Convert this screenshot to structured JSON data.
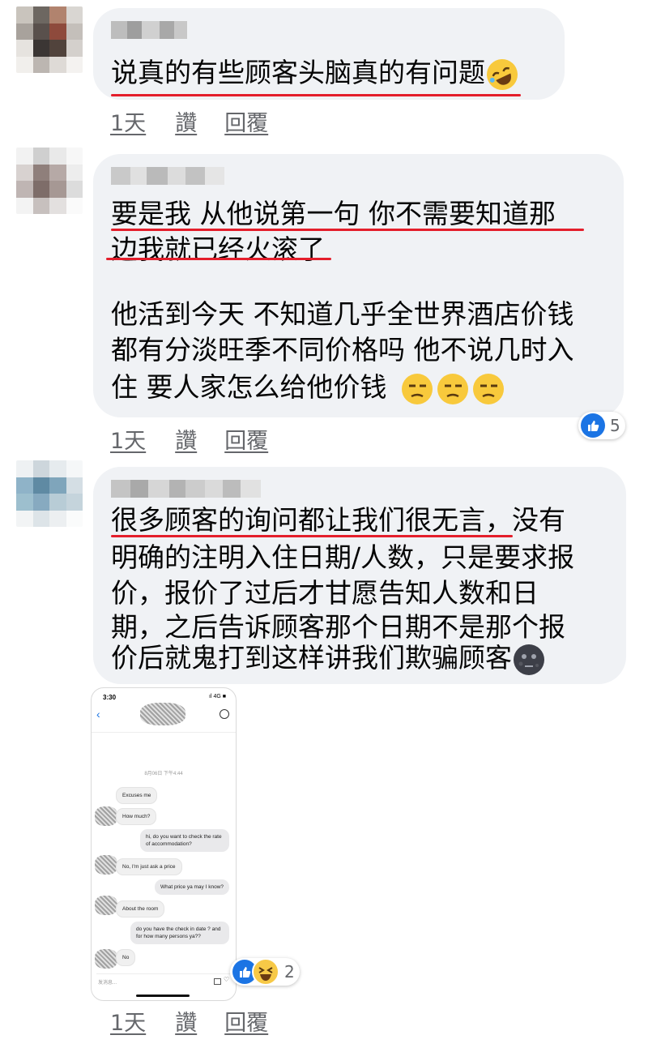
{
  "comments": [
    {
      "text_lines": [
        "说真的有些顾客头脑真的有问题"
      ],
      "emoji": "rolling-on-floor-laughing-emoji",
      "actions": {
        "time": "1天",
        "like": "讚",
        "reply": "回覆"
      }
    },
    {
      "text_lines": [
        "要是我 从他说第一句 你不需要知道那",
        "边我就已经火滚了",
        "他活到今天 不知道几乎全世界酒店价钱",
        "都有分淡旺季不同价格吗 他不说几时入",
        "住 要人家怎么给他价钱"
      ],
      "emoji": "unamused-face-emoji x3",
      "reaction": {
        "icon": "like-icon",
        "count": "5"
      },
      "actions": {
        "time": "1天",
        "like": "讚",
        "reply": "回覆"
      }
    },
    {
      "text_lines": [
        "很多顾客的询问都让我们很无言，没有",
        "明确的注明入住日期/人数，只是要求报",
        "价，报价了过后才甘愿告知人数和日",
        "期，之后告诉顾客那个日期不是那个报",
        "价后就鬼打到这样讲我们欺骗顾客"
      ],
      "emoji": "new-moon-face-emoji",
      "reaction": {
        "icons": [
          "like-icon",
          "haha-icon"
        ],
        "count": "2"
      },
      "actions": {
        "time": "1天",
        "like": "讚",
        "reply": "回覆"
      }
    }
  ],
  "phone": {
    "time": "3:30",
    "status": "ıl 4G ■",
    "date": "8月06日 下午4:44",
    "messages": [
      {
        "side": "in",
        "text": "Excuses me"
      },
      {
        "side": "in",
        "text": "How much?"
      },
      {
        "side": "out",
        "text": "hi, do you want to check the rate of accommodation?"
      },
      {
        "side": "in",
        "text": "No, I'm just ask a price"
      },
      {
        "side": "out",
        "text": "What price ya may I know?"
      },
      {
        "side": "in",
        "text": "About the room"
      },
      {
        "side": "out",
        "text": "do you have the check in date ? and for how many persons ya??"
      },
      {
        "side": "in",
        "text": "No"
      }
    ],
    "input_placeholder": "发消息..."
  },
  "colors": {
    "bubble": "#f0f2f5",
    "underline": "#e41e2b",
    "meta": "#65676b",
    "like": "#1b74e4"
  }
}
